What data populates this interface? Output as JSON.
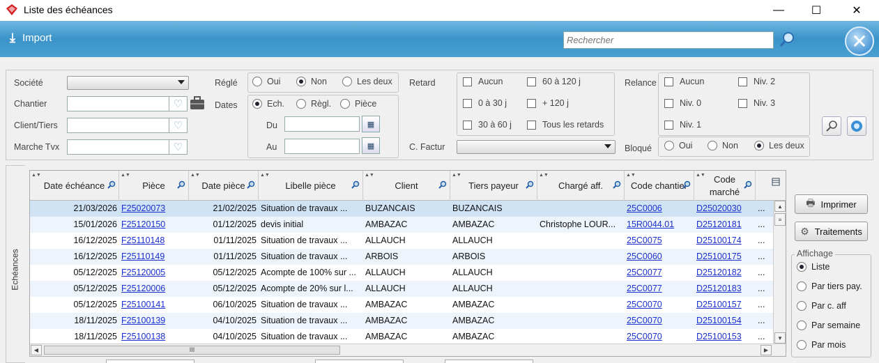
{
  "window": {
    "title": "Liste des échéances",
    "minimize": "—",
    "maximize": "☐",
    "close": "✕"
  },
  "toolbar": {
    "import_label": "Import",
    "search_placeholder": "Rechercher"
  },
  "filters": {
    "societe_label": "Société",
    "chantier_label": "Chantier",
    "client_tiers_label": "Client/Tiers",
    "marche_label": "Marche Tvx",
    "regle_label": "Réglé",
    "regle_options": [
      {
        "label": "Oui",
        "checked": false
      },
      {
        "label": "Non",
        "checked": true
      },
      {
        "label": "Les deux",
        "checked": false
      }
    ],
    "dates_label": "Dates",
    "dates_options": [
      {
        "label": "Ech.",
        "checked": true
      },
      {
        "label": "Règl.",
        "checked": false
      },
      {
        "label": "Pièce",
        "checked": false
      }
    ],
    "du_label": "Du",
    "au_label": "Au",
    "retard_label": "Retard",
    "retard_options": [
      "Aucun",
      "60 à 120 j",
      "0 à 30 j",
      "+ 120 j",
      "30 à 60 j",
      "Tous les retards"
    ],
    "cfactur_label": "C. Factur",
    "relance_label": "Relance",
    "relance_options": [
      "Aucun",
      "Niv. 2",
      "Niv. 0",
      "Niv. 3",
      "Niv. 1"
    ],
    "bloque_label": "Bloqué",
    "bloque_options": [
      {
        "label": "Oui",
        "checked": false
      },
      {
        "label": "Non",
        "checked": false
      },
      {
        "label": "Les deux",
        "checked": true
      }
    ]
  },
  "tab_label": "Echéances",
  "table": {
    "columns": [
      "Date échéance",
      "Pièce",
      "Date pièce",
      "Libelle pièce",
      "Client",
      "Tiers payeur",
      "Chargé aff.",
      "Code chantier",
      "Code marché"
    ],
    "rows": [
      [
        "21/03/2026",
        "F25020073",
        "21/02/2025",
        "Situation de travaux ...",
        "BUZANCAIS",
        "BUZANCAIS",
        "",
        "25C0006",
        "D25020030",
        "..."
      ],
      [
        "15/01/2026",
        "F25120150",
        "01/12/2025",
        "devis initial",
        "AMBAZAC",
        "AMBAZAC",
        "Christophe LOUR...",
        "15R0044.01",
        "D25120181",
        "..."
      ],
      [
        "16/12/2025",
        "F25110148",
        "01/11/2025",
        "Situation de travaux ...",
        "ALLAUCH",
        "ALLAUCH",
        "",
        "25C0075",
        "D25100174",
        "..."
      ],
      [
        "16/12/2025",
        "F25110149",
        "01/11/2025",
        "Situation de travaux ...",
        "ARBOIS",
        "ARBOIS",
        "",
        "25C0060",
        "D25100175",
        "..."
      ],
      [
        "05/12/2025",
        "F25120005",
        "05/12/2025",
        "Acompte de 100% sur ...",
        "ALLAUCH",
        "ALLAUCH",
        "",
        "25C0077",
        "D25120182",
        "..."
      ],
      [
        "05/12/2025",
        "F25120006",
        "05/12/2025",
        "Acompte de 20% sur l...",
        "ALLAUCH",
        "ALLAUCH",
        "",
        "25C0077",
        "D25120183",
        "..."
      ],
      [
        "05/12/2025",
        "F25100141",
        "06/10/2025",
        "Situation de travaux ...",
        "AMBAZAC",
        "AMBAZAC",
        "",
        "25C0070",
        "D25100157",
        "..."
      ],
      [
        "18/11/2025",
        "F25100139",
        "04/10/2025",
        "Situation de travaux ...",
        "AMBAZAC",
        "AMBAZAC",
        "",
        "25C0070",
        "D25100154",
        "..."
      ],
      [
        "18/11/2025",
        "F25100138",
        "04/10/2025",
        "Situation de travaux ...",
        "AMBAZAC",
        "AMBAZAC",
        "",
        "25C0070",
        "D25100153",
        "..."
      ]
    ],
    "hscroll_grip": "III"
  },
  "side": {
    "print_label": "Imprimer",
    "traitements_label": "Traitements",
    "affichage_label": "Affichage",
    "affichage_options": [
      {
        "label": "Liste",
        "checked": true
      },
      {
        "label": "Par tiers pay.",
        "checked": false
      },
      {
        "label": "Par c. aff",
        "checked": false
      },
      {
        "label": "Par semaine",
        "checked": false
      },
      {
        "label": "Par mois",
        "checked": false
      }
    ]
  },
  "colors": {
    "accent": "#3a93c9",
    "link": "#1a2fd0",
    "selected_row": "#cfe3f5",
    "alt_row": "#eef4fb"
  }
}
